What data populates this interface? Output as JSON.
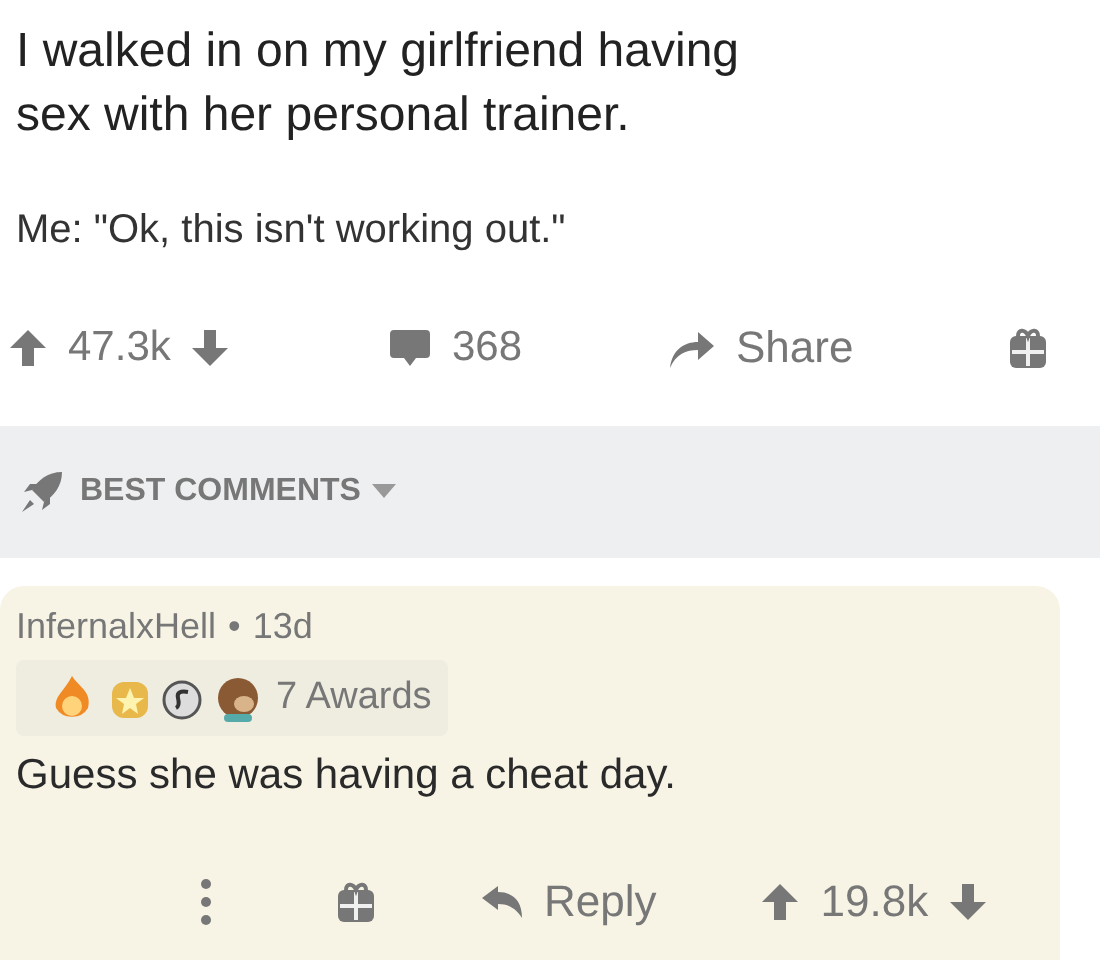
{
  "post": {
    "title": "I walked in on my girlfriend having sex with her personal trainer.",
    "body": "Me: \"Ok, this isn't working out.\"",
    "votes": "47.3k",
    "comments": "368",
    "share": "Share"
  },
  "sort": {
    "label": "BEST COMMENTS"
  },
  "comment": {
    "author": "InfernalxHell",
    "separator": "•",
    "age": "13d",
    "awards": "7 Awards",
    "body": "Guess she was having a cheat day.",
    "reply": "Reply",
    "votes": "19.8k"
  }
}
